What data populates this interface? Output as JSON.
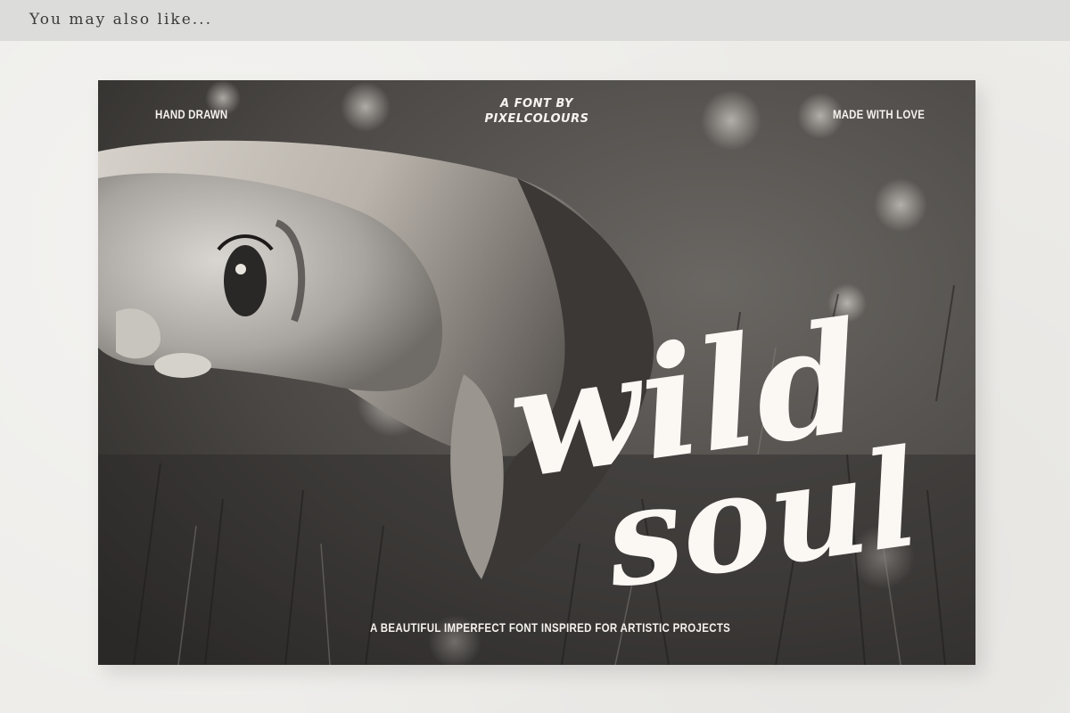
{
  "header": {
    "title": "You may also like..."
  },
  "card": {
    "top_left": "HAND DRAWN",
    "top_center_line1": "A FONT BY",
    "top_center_line2": "PIXELCOLOURS",
    "top_right": "MADE WITH LOVE",
    "title_line1": "wild",
    "title_line2": "soul",
    "tagline": "A BEAUTIFUL IMPERFECT FONT INSPIRED FOR ARTISTIC PROJECTS"
  },
  "colors": {
    "header_bg": "#dcdcda",
    "page_bg": "#edece9",
    "text_light": "#f5f2ee"
  }
}
